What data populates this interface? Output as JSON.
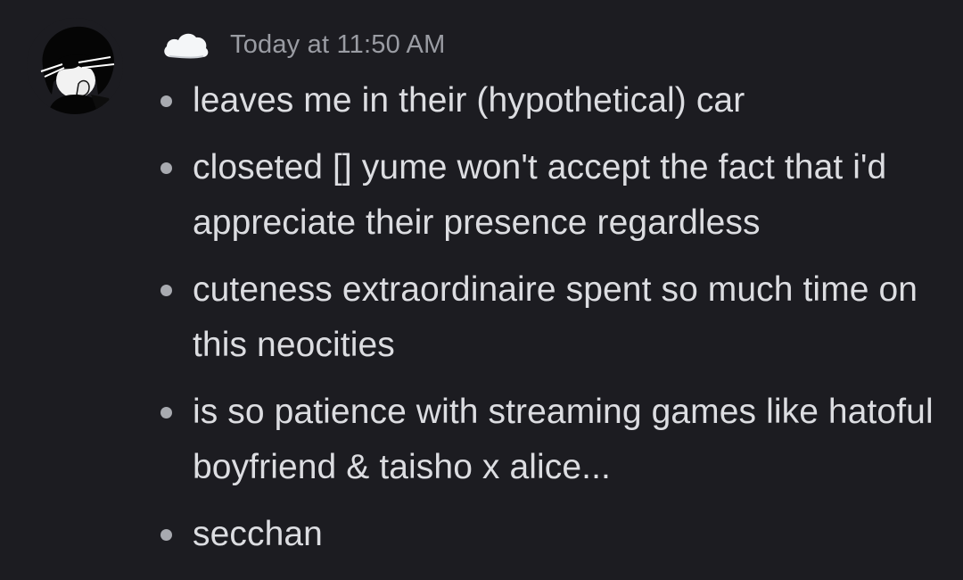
{
  "message": {
    "timestamp": "Today at 11:50 AM",
    "author_icon": "cloud-icon",
    "avatar_icon": "avatar-drawing",
    "bullets": [
      {
        "text": "leaves me in their (hypothetical) car"
      },
      {
        "text": "closeted [] yume won't accept the fact that i'd appreciate their presence regardless"
      },
      {
        "text": "cuteness extraordinaire spent so much time on this neocities"
      },
      {
        "text": "is so patience with streaming games like hatoful boyfriend & taisho x alice..."
      },
      {
        "text": "secchan"
      }
    ]
  },
  "colors": {
    "background": "#1c1c21",
    "text": "#dcdde1",
    "timestamp": "#9a9ca3",
    "bullet": "#a8aab0"
  }
}
